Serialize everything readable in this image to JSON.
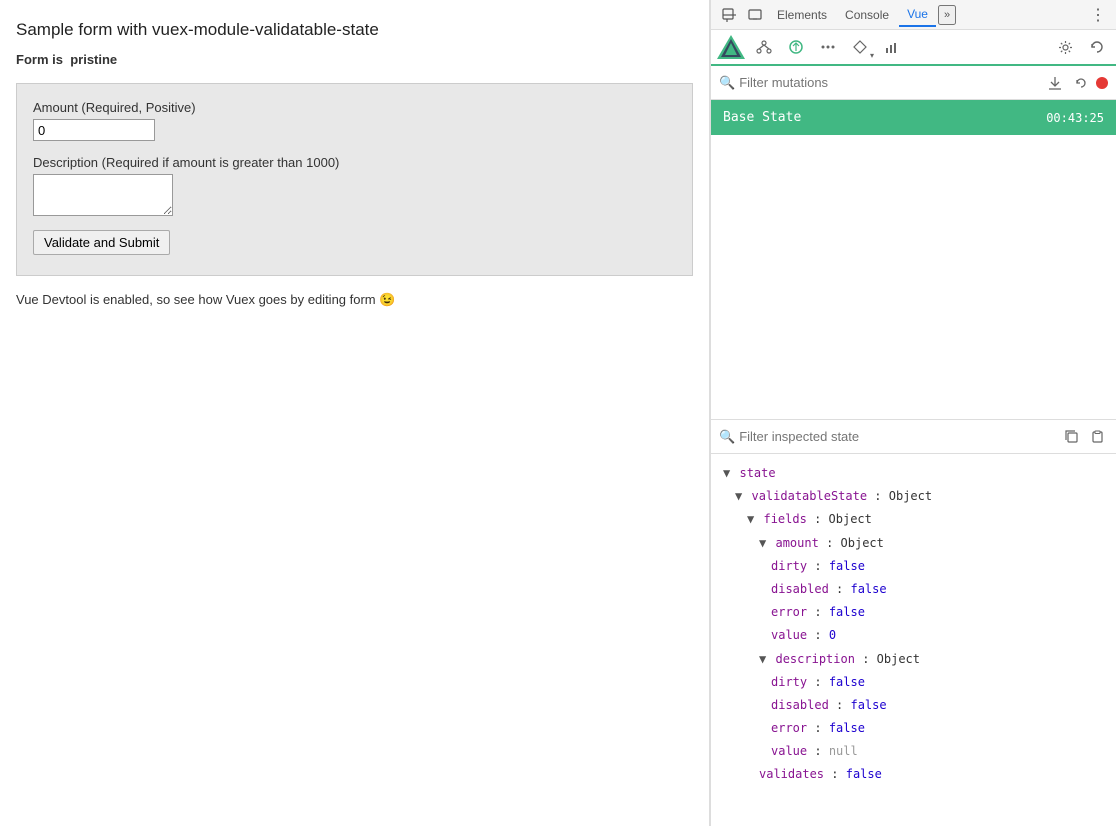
{
  "left": {
    "page_title": "Sample form with vuex-module-validatable-state",
    "form_status_prefix": "Form is",
    "form_status_value": "pristine",
    "amount_label": "Amount (Required, Positive)",
    "amount_value": "0",
    "description_label": "Description (Required if amount is greater than 1000)",
    "description_value": "",
    "submit_label": "Validate and Submit",
    "devtool_note": "Vue Devtool is enabled, so see how Vuex goes by editing form 😉"
  },
  "devtools": {
    "tabs": {
      "elements": "Elements",
      "console": "Console",
      "vue": "Vue",
      "more": "»"
    },
    "vue_tabs": {
      "component_icon": "👤",
      "vuex_icon": "🕐",
      "store_icon": "⬡",
      "router_icon": "◆",
      "performance_icon": "📊",
      "settings_icon": "⚙",
      "refresh_icon": "↻"
    },
    "filter_mutations": {
      "placeholder": "Filter mutations"
    },
    "mutations": [
      {
        "name": "Base State",
        "time": "00:43:25",
        "selected": true
      }
    ],
    "filter_state": {
      "placeholder": "Filter inspected state"
    },
    "state_tree": {
      "state_label": "state",
      "validatable_state_label": "validatableState",
      "fields_label": "fields",
      "amount_label": "amount",
      "amount_dirty_key": "dirty",
      "amount_dirty_value": "false",
      "amount_disabled_key": "disabled",
      "amount_disabled_value": "false",
      "amount_error_key": "error",
      "amount_error_value": "false",
      "amount_value_key": "value",
      "amount_value_value": "0",
      "description_label": "description",
      "desc_dirty_key": "dirty",
      "desc_dirty_value": "false",
      "desc_disabled_key": "disabled",
      "desc_disabled_value": "false",
      "desc_error_key": "error",
      "desc_error_value": "false",
      "desc_value_key": "value",
      "desc_value_value": "null",
      "validates_key": "validates",
      "validates_value": "false"
    }
  }
}
